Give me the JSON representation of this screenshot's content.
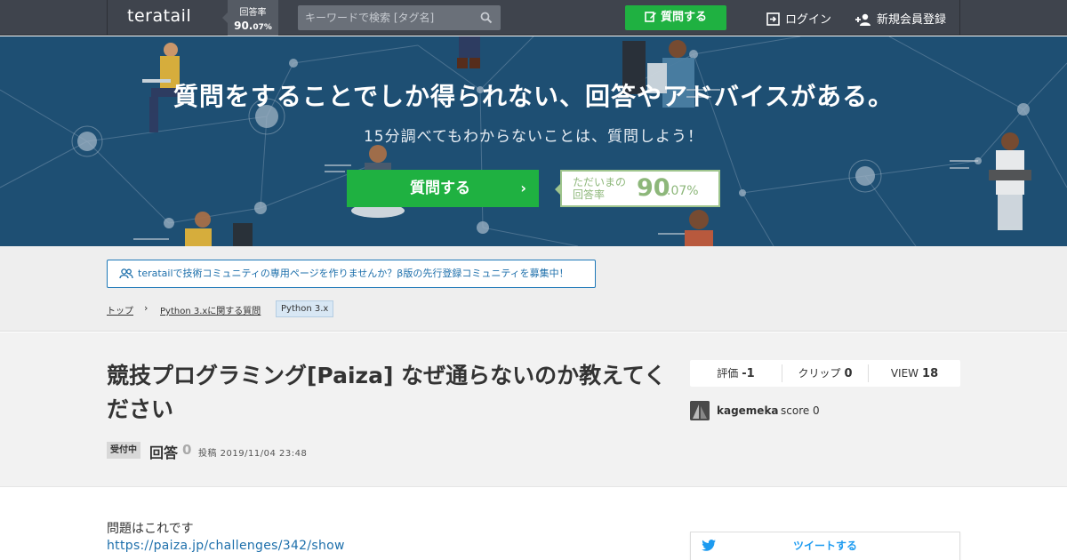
{
  "header": {
    "logo": "teratail",
    "rate_label": "回答率",
    "rate_int": "90.",
    "rate_dec": "07%",
    "search_placeholder": "キーワードで検索 [タグ名]",
    "ask_button": "質問する",
    "login": "ログイン",
    "signup": "新規会員登録"
  },
  "hero": {
    "title": "質問をすることでしか得られない、回答やアドバイスがある。",
    "subtitle": "15分調べてもわからないことは、質問しよう！",
    "ask_button": "質問する",
    "arrow": "›",
    "rate_label": "ただいまの回答率",
    "rate_int": "90",
    "rate_dec": ".07%"
  },
  "notice": {
    "text": "teratailで技術コミュニティの専用ページを作りませんか？β版の先行登録コミュニティを募集中！"
  },
  "breadcrumb": {
    "items": [
      "トップ",
      "Python 3.xに関する質問"
    ],
    "separator": "›",
    "tag": "Python 3.x"
  },
  "question": {
    "title": "競技プログラミング[Paiza] なぜ通らないのか教えてください",
    "status": "受付中",
    "answer_label": "回答",
    "answer_count": "0",
    "posted": "投稿 2019/11/04 23:48",
    "stats": {
      "rating_label": "評価",
      "rating": "-1",
      "clip_label": "クリップ",
      "clip": "0",
      "view_label": "VIEW",
      "view": "18"
    },
    "user": {
      "name": "kagemeka",
      "score": "score 0"
    },
    "body_text": "問題はこれです",
    "body_link": "https://paiza.jp/challenges/342/show"
  },
  "share": {
    "tweet": "ツイートする"
  },
  "colors": {
    "header_bg": "#3f444d",
    "hero_bg": "#1e4f73",
    "green": "#1fb141",
    "link": "#1d6fab"
  }
}
